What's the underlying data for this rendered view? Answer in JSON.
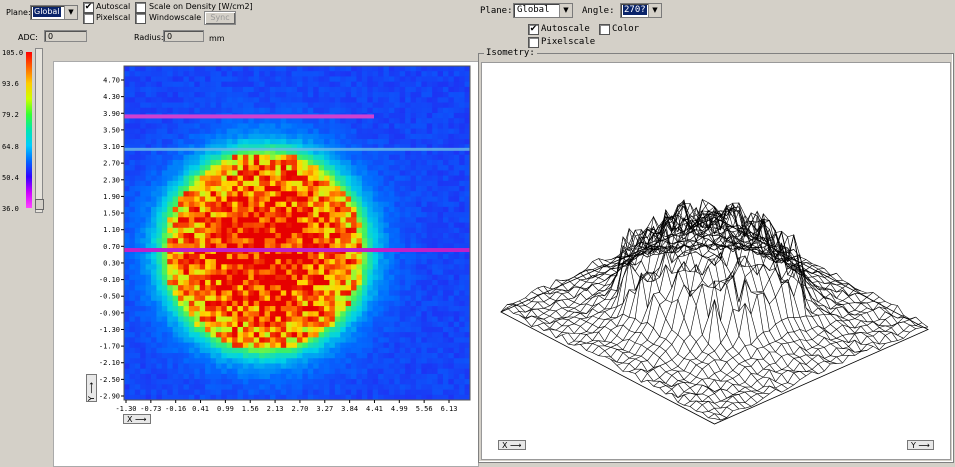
{
  "left_panel": {
    "plane_label": "Plane:",
    "plane_value": "Global",
    "autoscale_label": "Autoscal",
    "autoscale_checked": true,
    "pixelscale_label": "Pixelscal",
    "pixelscale_checked": false,
    "scale_density_label": "Scale on Density [W/cm2]",
    "scale_density_checked": false,
    "windowscale_label": "Windowscale",
    "windowscale_checked": false,
    "sync_button": "Sync",
    "adc_label": "ADC:",
    "adc_value": "0",
    "radius_label": "Radius:",
    "radius_value": "0",
    "radius_unit": "mm"
  },
  "colorbar": {
    "ticks": [
      "105.0",
      "93.6",
      "79.2",
      "64.8",
      "50.4",
      "36.0"
    ],
    "colors": [
      "#ff0000",
      "#ff6600",
      "#ffcc00",
      "#ccff00",
      "#33ff33",
      "#00e6b0",
      "#00ccff",
      "#0066ff",
      "#3300ff",
      "#cc00ff",
      "#ff44ff"
    ]
  },
  "heatmap": {
    "y_ticks": [
      "4.70",
      "4.30",
      "3.90",
      "3.50",
      "3.10",
      "2.70",
      "2.30",
      "1.90",
      "1.50",
      "1.10",
      "0.70",
      "0.30",
      "-0.10",
      "-0.50",
      "-0.90",
      "-1.30",
      "-1.70",
      "-2.10",
      "-2.50",
      "-2.90"
    ],
    "x_ticks": [
      "-1.30",
      "-0.73",
      "-0.16",
      "0.41",
      "0.99",
      "1.56",
      "2.13",
      "2.70",
      "3.27",
      "3.84",
      "4.41",
      "4.99",
      "5.56",
      "6.13"
    ],
    "x_axis_button": "X ⟶",
    "y_axis_button": "Y ⟶"
  },
  "right_panel": {
    "plane_label": "Plane:",
    "plane_value": "Global",
    "angle_label": "Angle:",
    "angle_value": "270?",
    "autoscale_label": "Autoscale",
    "autoscale_checked": true,
    "color_label": "Color",
    "color_checked": false,
    "pixelscale_label": "Pixelscale",
    "pixelscale_checked": false,
    "group_title": "Isometry:",
    "x_axis_button": "X ⟶",
    "y_axis_button": "Y ⟶"
  }
}
